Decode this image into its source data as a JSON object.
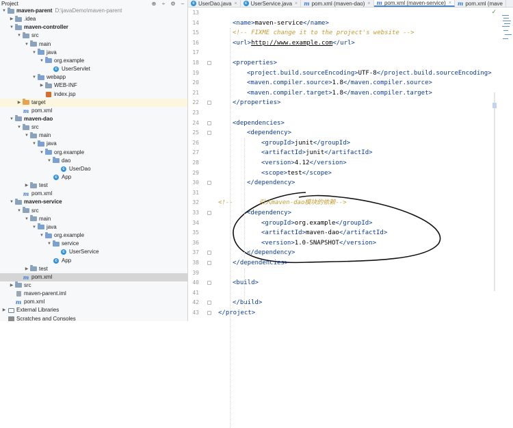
{
  "project_panel": {
    "title": "Project",
    "header_icons": [
      "gear-icon",
      "collapse-icon",
      "settings-icon",
      "minimize-icon"
    ],
    "tree": [
      {
        "label": "maven-parent",
        "path": "D:\\javaDemo\\maven-parent",
        "indent": 0,
        "arrow": "down",
        "icon": "module-folder",
        "bold": true
      },
      {
        "label": ".idea",
        "indent": 1,
        "arrow": "right",
        "icon": "folder"
      },
      {
        "label": "maven-controller",
        "indent": 1,
        "arrow": "down",
        "icon": "module-folder",
        "bold": true
      },
      {
        "label": "src",
        "indent": 2,
        "arrow": "down",
        "icon": "folder"
      },
      {
        "label": "main",
        "indent": 3,
        "arrow": "down",
        "icon": "folder"
      },
      {
        "label": "java",
        "indent": 4,
        "arrow": "down",
        "icon": "source-folder"
      },
      {
        "label": "org.example",
        "indent": 5,
        "arrow": "down",
        "icon": "package"
      },
      {
        "label": "UserServlet",
        "indent": 6,
        "arrow": "",
        "icon": "class"
      },
      {
        "label": "webapp",
        "indent": 4,
        "arrow": "down",
        "icon": "web-folder"
      },
      {
        "label": "WEB-INF",
        "indent": 5,
        "arrow": "right",
        "icon": "folder"
      },
      {
        "label": "index.jsp",
        "indent": 5,
        "arrow": "",
        "icon": "jsp"
      },
      {
        "label": "target",
        "indent": 2,
        "arrow": "right",
        "icon": "excluded-folder",
        "highlight": true
      },
      {
        "label": "pom.xml",
        "indent": 2,
        "arrow": "",
        "icon": "maven"
      },
      {
        "label": "maven-dao",
        "indent": 1,
        "arrow": "down",
        "icon": "module-folder",
        "bold": true
      },
      {
        "label": "src",
        "indent": 2,
        "arrow": "down",
        "icon": "folder"
      },
      {
        "label": "main",
        "indent": 3,
        "arrow": "down",
        "icon": "folder"
      },
      {
        "label": "java",
        "indent": 4,
        "arrow": "down",
        "icon": "source-folder"
      },
      {
        "label": "org.example",
        "indent": 5,
        "arrow": "down",
        "icon": "package"
      },
      {
        "label": "dao",
        "indent": 6,
        "arrow": "down",
        "icon": "package"
      },
      {
        "label": "UserDao",
        "indent": 7,
        "arrow": "",
        "icon": "class"
      },
      {
        "label": "App",
        "indent": 6,
        "arrow": "",
        "icon": "app-class"
      },
      {
        "label": "test",
        "indent": 3,
        "arrow": "right",
        "icon": "folder"
      },
      {
        "label": "pom.xml",
        "indent": 2,
        "arrow": "",
        "icon": "maven"
      },
      {
        "label": "maven-service",
        "indent": 1,
        "arrow": "down",
        "icon": "module-folder",
        "bold": true
      },
      {
        "label": "src",
        "indent": 2,
        "arrow": "down",
        "icon": "folder"
      },
      {
        "label": "main",
        "indent": 3,
        "arrow": "down",
        "icon": "folder"
      },
      {
        "label": "java",
        "indent": 4,
        "arrow": "down",
        "icon": "source-folder"
      },
      {
        "label": "org.example",
        "indent": 5,
        "arrow": "down",
        "icon": "package"
      },
      {
        "label": "service",
        "indent": 6,
        "arrow": "down",
        "icon": "package"
      },
      {
        "label": "UserService",
        "indent": 7,
        "arrow": "",
        "icon": "class"
      },
      {
        "label": "App",
        "indent": 6,
        "arrow": "",
        "icon": "app-class"
      },
      {
        "label": "test",
        "indent": 3,
        "arrow": "right",
        "icon": "folder"
      },
      {
        "label": "pom.xml",
        "indent": 2,
        "arrow": "",
        "icon": "maven",
        "selected": true
      },
      {
        "label": "src",
        "indent": 1,
        "arrow": "right",
        "icon": "folder"
      },
      {
        "label": "maven-parent.iml",
        "indent": 1,
        "arrow": "",
        "icon": "iml"
      },
      {
        "label": "pom.xml",
        "indent": 1,
        "arrow": "",
        "icon": "maven"
      },
      {
        "label": "External Libraries",
        "indent": 0,
        "arrow": "right",
        "icon": "libraries"
      },
      {
        "label": "Scratches and Consoles",
        "indent": 0,
        "arrow": "",
        "icon": "scratches"
      }
    ]
  },
  "editor": {
    "tabs": [
      {
        "label": "UserDao.java",
        "icon": "class"
      },
      {
        "label": "UserService.java",
        "icon": "class"
      },
      {
        "label": "pom.xml (maven-dao)",
        "icon": "maven"
      },
      {
        "label": "pom.xml (maven-service)",
        "icon": "maven",
        "active": true
      },
      {
        "label": "pom.xml (mave",
        "icon": "maven"
      }
    ],
    "status_icon": "check-icon",
    "lines": [
      {
        "n": "13",
        "indent": 0,
        "parts": []
      },
      {
        "n": "14",
        "indent": 1,
        "parts": [
          [
            "tag",
            "<name>"
          ],
          [
            "val",
            "maven-service"
          ],
          [
            "tag",
            "</name>"
          ]
        ]
      },
      {
        "n": "15",
        "indent": 1,
        "parts": [
          [
            "cmt",
            "<!-- FIXME change it to the project's website -->"
          ]
        ]
      },
      {
        "n": "16",
        "indent": 1,
        "parts": [
          [
            "tag",
            "<url>"
          ],
          [
            "url",
            "http://www.example.com"
          ],
          [
            "tag",
            "</url>"
          ]
        ]
      },
      {
        "n": "17",
        "indent": 0,
        "parts": []
      },
      {
        "n": "18",
        "indent": 1,
        "parts": [
          [
            "tag",
            "<properties>"
          ]
        ],
        "fold": true
      },
      {
        "n": "19",
        "indent": 2,
        "parts": [
          [
            "tag",
            "<project.build.sourceEncoding>"
          ],
          [
            "val",
            "UTF-8"
          ],
          [
            "tag",
            "</project.build.sourceEncoding>"
          ]
        ]
      },
      {
        "n": "20",
        "indent": 2,
        "parts": [
          [
            "tag",
            "<maven.compiler.source>"
          ],
          [
            "val",
            "1.8"
          ],
          [
            "tag",
            "</maven.compiler.source>"
          ]
        ]
      },
      {
        "n": "21",
        "indent": 2,
        "parts": [
          [
            "tag",
            "<maven.compiler.target>"
          ],
          [
            "val",
            "1.8"
          ],
          [
            "tag",
            "</maven.compiler.target>"
          ]
        ]
      },
      {
        "n": "22",
        "indent": 1,
        "parts": [
          [
            "tag",
            "</properties>"
          ]
        ],
        "fold": true
      },
      {
        "n": "23",
        "indent": 0,
        "parts": []
      },
      {
        "n": "24",
        "indent": 1,
        "parts": [
          [
            "tag",
            "<dependencies>"
          ]
        ],
        "fold": true
      },
      {
        "n": "25",
        "indent": 2,
        "parts": [
          [
            "tag",
            "<dependency>"
          ]
        ],
        "fold": true
      },
      {
        "n": "26",
        "indent": 3,
        "parts": [
          [
            "tag",
            "<groupId>"
          ],
          [
            "val",
            "junit"
          ],
          [
            "tag",
            "</groupId>"
          ]
        ]
      },
      {
        "n": "27",
        "indent": 3,
        "parts": [
          [
            "tag",
            "<artifactId>"
          ],
          [
            "val",
            "junit"
          ],
          [
            "tag",
            "</artifactId>"
          ]
        ]
      },
      {
        "n": "28",
        "indent": 3,
        "parts": [
          [
            "tag",
            "<version>"
          ],
          [
            "val",
            "4.12"
          ],
          [
            "tag",
            "</version>"
          ]
        ]
      },
      {
        "n": "29",
        "indent": 3,
        "parts": [
          [
            "tag",
            "<scope>"
          ],
          [
            "val",
            "test"
          ],
          [
            "tag",
            "</scope>"
          ]
        ]
      },
      {
        "n": "30",
        "indent": 2,
        "parts": [
          [
            "tag",
            "</dependency>"
          ]
        ],
        "fold": true
      },
      {
        "n": "31",
        "indent": 0,
        "parts": []
      },
      {
        "n": "32",
        "indent": 0,
        "parts": [
          [
            "cmt",
            "<!--       引入maven-dao模块的依赖-->"
          ]
        ]
      },
      {
        "n": "33",
        "indent": 2,
        "parts": [
          [
            "tag",
            "<dependency>"
          ]
        ],
        "fold": true
      },
      {
        "n": "34",
        "indent": 3,
        "parts": [
          [
            "tag",
            "<groupId>"
          ],
          [
            "val",
            "org.example"
          ],
          [
            "tag",
            "</groupId>"
          ]
        ]
      },
      {
        "n": "35",
        "indent": 3,
        "parts": [
          [
            "tag",
            "<artifactId>"
          ],
          [
            "val",
            "maven-dao"
          ],
          [
            "tag",
            "</artifactId>"
          ]
        ]
      },
      {
        "n": "36",
        "indent": 3,
        "parts": [
          [
            "tag",
            "<version>"
          ],
          [
            "val",
            "1.0-SNAPSHOT"
          ],
          [
            "tag",
            "</version>"
          ]
        ]
      },
      {
        "n": "37",
        "indent": 2,
        "parts": [
          [
            "tag",
            "</dependency>"
          ]
        ],
        "fold": true
      },
      {
        "n": "38",
        "indent": 1,
        "parts": [
          [
            "tag",
            "</dependencies>"
          ]
        ],
        "fold": true
      },
      {
        "n": "39",
        "indent": 0,
        "parts": []
      },
      {
        "n": "40",
        "indent": 1,
        "parts": [
          [
            "tag",
            "<build>"
          ]
        ],
        "fold": true
      },
      {
        "n": "41",
        "indent": 0,
        "parts": []
      },
      {
        "n": "42",
        "indent": 1,
        "parts": [
          [
            "tag",
            "</build>"
          ]
        ],
        "fold": true
      },
      {
        "n": "43",
        "indent": 0,
        "parts": [
          [
            "tag",
            "</project>"
          ]
        ],
        "fold": true
      }
    ]
  }
}
